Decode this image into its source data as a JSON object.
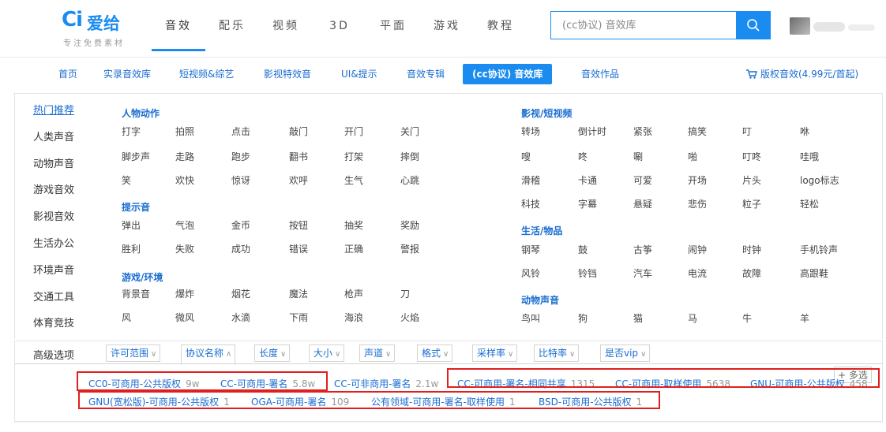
{
  "logo": {
    "mark": "Ci",
    "name": "爱给",
    "slogan": "专注免费素材"
  },
  "topnav": [
    "音效",
    "配乐",
    "视频",
    "3D",
    "平面",
    "游戏",
    "教程"
  ],
  "search": {
    "placeholder": "(cc协议) 音效库"
  },
  "subnav": {
    "items": [
      "首页",
      "实录音效库",
      "短视频&综艺",
      "影视特效音",
      "UI&提示",
      "音效专辑",
      "(cc协议) 音效库",
      "音效作品"
    ],
    "active_index": 6,
    "copyright": "版权音效(4.99元/首起)"
  },
  "sidebar": [
    "热门推荐",
    "人类声音",
    "动物声音",
    "游戏音效",
    "影视音效",
    "生活办公",
    "环境声音",
    "交通工具",
    "体育竞技"
  ],
  "groups": {
    "human": {
      "title": "人物动作",
      "tags": [
        "打字",
        "拍照",
        "点击",
        "敲门",
        "开门",
        "关门",
        "脚步声",
        "走路",
        "跑步",
        "翻书",
        "打架",
        "摔倒",
        "笑",
        "欢快",
        "惊讶",
        "欢呼",
        "生气",
        "心跳"
      ]
    },
    "prompt": {
      "title": "提示音",
      "tags": [
        "弹出",
        "气泡",
        "金币",
        "按钮",
        "抽奖",
        "奖励",
        "胜利",
        "失败",
        "成功",
        "错误",
        "正确",
        "警报"
      ]
    },
    "game": {
      "title": "游戏/环境",
      "tags": [
        "背景音",
        "爆炸",
        "烟花",
        "魔法",
        "枪声",
        "刀",
        "风",
        "微风",
        "水滴",
        "下雨",
        "海浪",
        "火焰"
      ]
    },
    "film": {
      "title": "影视/短视频",
      "tags": [
        "转场",
        "倒计时",
        "紧张",
        "搞笑",
        "叮",
        "咻",
        "嗖",
        "咚",
        "唰",
        "啪",
        "叮咚",
        "哇哦",
        "滑稽",
        "卡通",
        "可爱",
        "开场",
        "片头",
        "logo标志",
        "科技",
        "字幕",
        "悬疑",
        "悲伤",
        "粒子",
        "轻松"
      ]
    },
    "life": {
      "title": "生活/物品",
      "tags": [
        "钢琴",
        "鼓",
        "古筝",
        "闹钟",
        "时钟",
        "手机铃声",
        "风铃",
        "铃铛",
        "汽车",
        "电流",
        "故障",
        "高跟鞋"
      ]
    },
    "animal": {
      "title": "动物声音",
      "tags": [
        "鸟叫",
        "狗",
        "猫",
        "马",
        "牛",
        "羊"
      ]
    }
  },
  "advanced": {
    "label": "高级选项",
    "filters": [
      "许可范围",
      "协议名称",
      "长度",
      "大小",
      "声道",
      "格式",
      "采样率",
      "比特率",
      "是否vip"
    ],
    "open_index": 1,
    "multi": "+ 多选"
  },
  "license_options": [
    {
      "name": "CC0-可商用-公共版权",
      "count": "9w"
    },
    {
      "name": "CC-可商用-署名",
      "count": "5.8w"
    },
    {
      "name": "CC-可非商用-署名",
      "count": "2.1w"
    },
    {
      "name": "CC-可商用-署名-相同共享",
      "count": "1315"
    },
    {
      "name": "CC-可商用-取样使用",
      "count": "5638"
    },
    {
      "name": "GNU-可商用-公共版权",
      "count": "458"
    },
    {
      "name": "GNU(宽松版)-可商用-公共版权",
      "count": "1"
    },
    {
      "name": "OGA-可商用-署名",
      "count": "109"
    },
    {
      "name": "公有领域-可商用-署名-取样使用",
      "count": "1"
    },
    {
      "name": "BSD-可商用-公共版权",
      "count": "1"
    }
  ],
  "colors": {
    "accent": "#1a8cf0",
    "link": "#1a6dd0",
    "highlight": "#e02020"
  }
}
